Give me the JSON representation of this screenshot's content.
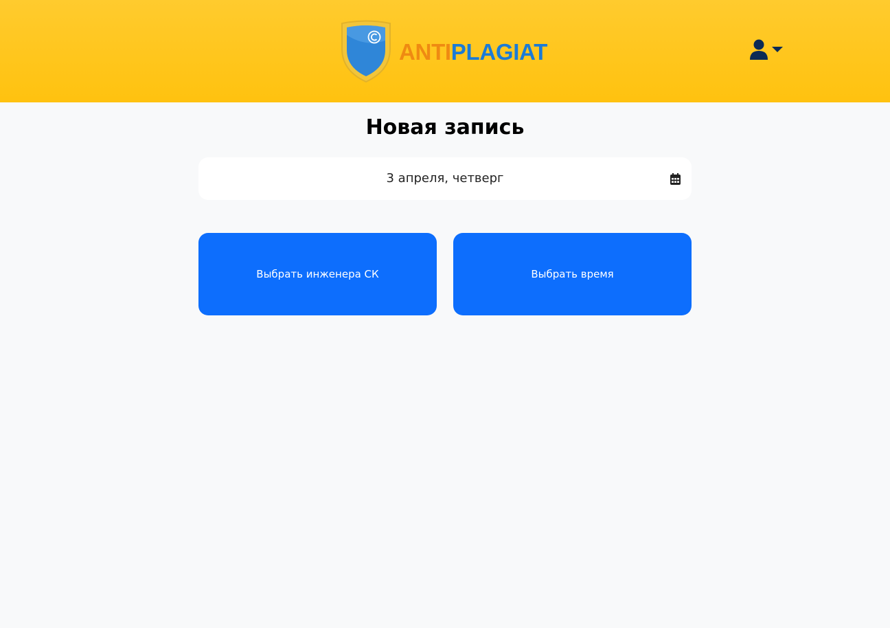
{
  "header": {
    "logo": {
      "text_part1": "ANTI",
      "text_part2": "PLAGIAT",
      "icon": "copyright-shield-icon",
      "colors": {
        "anti": "#ef8a12",
        "plagiat": "#1b7bd6",
        "shield": "#2f86d8"
      }
    },
    "user_menu": {
      "icon": "user-icon",
      "dropdown_icon": "caret-down-icon"
    },
    "background_color": "#ffc20f"
  },
  "main": {
    "title": "Новая запись",
    "date_picker": {
      "value": "3 апреля, четверг",
      "icon": "calendar-icon"
    },
    "buttons": [
      {
        "label": "Выбрать инженера СК"
      },
      {
        "label": "Выбрать время"
      }
    ],
    "accent_color": "#0d6efd"
  }
}
